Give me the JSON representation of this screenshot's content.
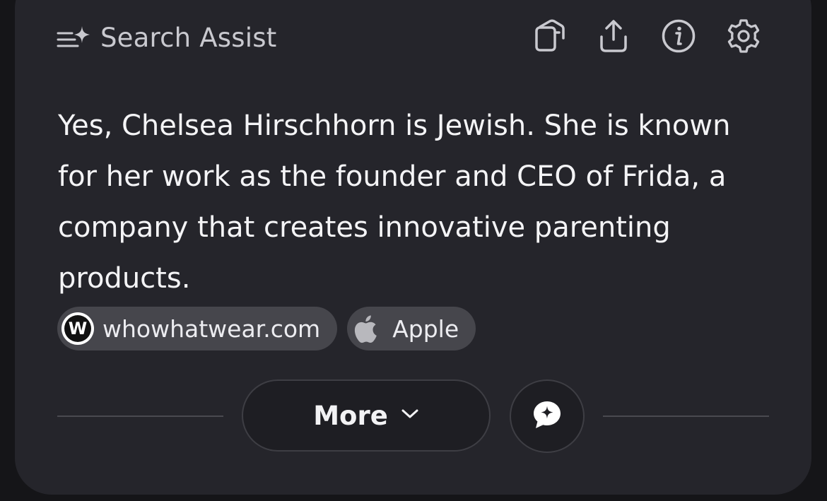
{
  "header": {
    "title": "Search Assist",
    "icon": "assist-sparkle-icon"
  },
  "toolbar": {
    "icons": [
      "copy-icon",
      "share-icon",
      "info-icon",
      "settings-gear-icon"
    ]
  },
  "answer": {
    "text": "Yes, Chelsea Hirschhorn is Jewish. She is known for her work as the founder and CEO of Frida, a company that creates innovative parenting products."
  },
  "sources": [
    {
      "label": "whowhatwear.com",
      "icon": "whowhatwear-favicon"
    },
    {
      "label": "Apple",
      "icon": "apple-logo-icon"
    }
  ],
  "more_button": {
    "label": "More",
    "icon": "chevron-down-icon"
  },
  "chat_button": {
    "icon": "chat-sparkle-icon"
  },
  "colors": {
    "background": "#151518",
    "card": "#25252b",
    "chip": "#46464c",
    "text": "#f4f4f6",
    "muted_text": "#c9c9cf"
  }
}
